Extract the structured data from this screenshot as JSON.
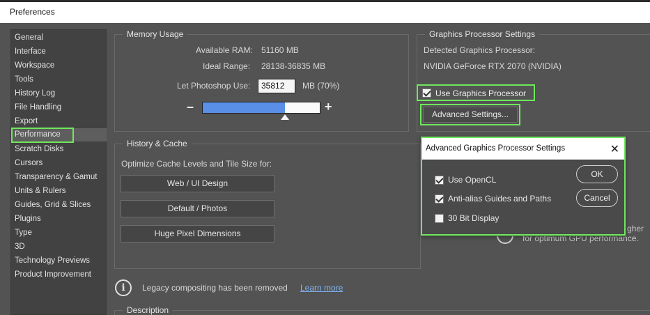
{
  "window": {
    "title": "Preferences"
  },
  "sidebar": {
    "items": [
      {
        "label": "General"
      },
      {
        "label": "Interface"
      },
      {
        "label": "Workspace"
      },
      {
        "label": "Tools"
      },
      {
        "label": "History Log"
      },
      {
        "label": "File Handling"
      },
      {
        "label": "Export"
      },
      {
        "label": "Performance"
      },
      {
        "label": "Scratch Disks"
      },
      {
        "label": "Cursors"
      },
      {
        "label": "Transparency & Gamut"
      },
      {
        "label": "Units & Rulers"
      },
      {
        "label": "Guides, Grid & Slices"
      },
      {
        "label": "Plugins"
      },
      {
        "label": "Type"
      },
      {
        "label": "3D"
      },
      {
        "label": "Technology Previews"
      },
      {
        "label": "Product Improvement"
      }
    ],
    "selected": "Performance"
  },
  "memory": {
    "title": "Memory Usage",
    "available_label": "Available RAM:",
    "available_value": "51160 MB",
    "ideal_label": "Ideal Range:",
    "ideal_value": "28138-36835 MB",
    "let_label": "Let Photoshop Use:",
    "let_value": "35812",
    "let_unit": "MB (70%)",
    "slider_fraction": 0.7,
    "minus": "–",
    "plus": "+"
  },
  "history": {
    "title": "History & Cache",
    "optimize_label": "Optimize Cache Levels and Tile Size for:",
    "buttons": [
      "Web / UI Design",
      "Default / Photos",
      "Huge Pixel Dimensions"
    ]
  },
  "gpu": {
    "title": "Graphics Processor Settings",
    "detected_label": "Detected Graphics Processor:",
    "detected_value": "NVIDIA GeForce RTX 2070 (NVIDIA)",
    "use_gpu_label": "Use Graphics Processor",
    "use_gpu_checked": true,
    "advanced_button": "Advanced Settings..."
  },
  "dialog": {
    "title": "Advanced Graphics Processor Settings",
    "close": "✕",
    "options": [
      {
        "label": "Use OpenCL",
        "checked": true
      },
      {
        "label": "Anti-alias Guides and Paths",
        "checked": true
      },
      {
        "label": "30 Bit Display",
        "checked": false
      }
    ],
    "ok": "OK",
    "cancel": "Cancel"
  },
  "behind_dialog": {
    "line1": "gher",
    "line2": "for optimum GPU performance."
  },
  "legacy": {
    "icon": "i",
    "text": "Legacy compositing has been removed",
    "link": "Learn more"
  },
  "description": {
    "title": "Description"
  },
  "colors": {
    "highlight": "#6fe85c",
    "slider": "#5a8fe8",
    "link": "#7fb3f0"
  }
}
